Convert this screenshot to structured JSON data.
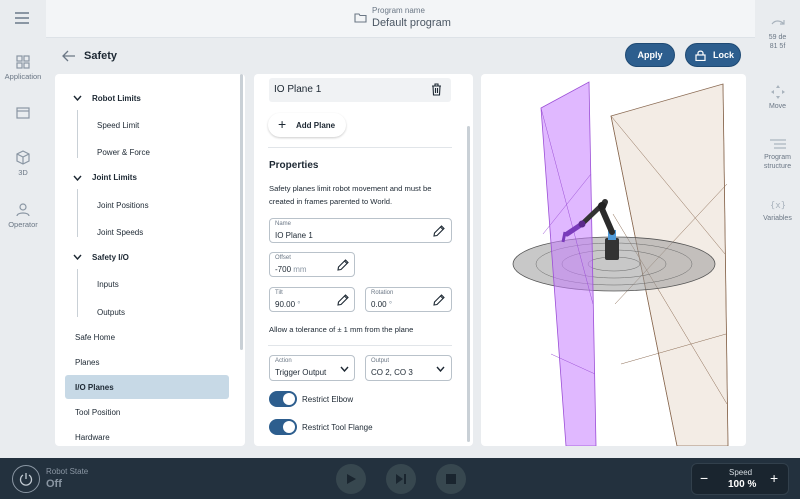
{
  "left_rail": {
    "items": [
      {
        "label": "Application",
        "icon": "grid-icon"
      },
      {
        "label": "",
        "icon": "window-icon"
      },
      {
        "label": "3D",
        "icon": "cube-icon"
      },
      {
        "label": "Operator",
        "icon": "person-icon"
      }
    ]
  },
  "right_rail": {
    "items": [
      {
        "label": "59 de\n81 5f",
        "icon": "handguide-icon"
      },
      {
        "label": "Move",
        "icon": "move-icon"
      },
      {
        "label": "Program\nstructure",
        "icon": "list-icon"
      },
      {
        "label": "Variables",
        "icon": "variable-icon"
      }
    ]
  },
  "header": {
    "program_label": "Program name",
    "program_name": "Default program"
  },
  "page": {
    "title": "Safety",
    "apply_label": "Apply",
    "lock_label": "Lock"
  },
  "nav": {
    "groups": [
      {
        "label": "Robot Limits",
        "items": [
          "Speed Limit",
          "Power & Force"
        ]
      },
      {
        "label": "Joint Limits",
        "items": [
          "Joint Positions",
          "Joint Speeds"
        ]
      },
      {
        "label": "Safety I/O",
        "items": [
          "Inputs",
          "Outputs"
        ]
      }
    ],
    "flat_items": [
      "Safe Home",
      "Planes",
      "I/O Planes",
      "Tool Position",
      "Hardware"
    ],
    "selected": "I/O Planes"
  },
  "plane": {
    "name_header": "IO Plane 1",
    "add_label": "Add Plane",
    "properties_title": "Properties",
    "description": "Safety planes limit robot movement and must be created in frames parented to World.",
    "name_field": {
      "label": "Name",
      "value": "IO Plane 1"
    },
    "offset_field": {
      "label": "Offset",
      "value": "-700",
      "unit": "mm"
    },
    "tilt_field": {
      "label": "Tilt",
      "value": "90.00",
      "unit": "°"
    },
    "rotation_field": {
      "label": "Rotation",
      "value": "0.00",
      "unit": "°"
    },
    "tolerance_note": "Allow a tolerance of ± 1 mm from the plane",
    "action_field": {
      "label": "Action",
      "value": "Trigger Output"
    },
    "output_field": {
      "label": "Output",
      "value": "CO 2, CO 3"
    },
    "toggles": [
      {
        "label": "Restrict Elbow",
        "on": true
      },
      {
        "label": "Restrict Tool Flange",
        "on": true
      }
    ]
  },
  "bottom": {
    "robot_state_label": "Robot State",
    "robot_state_value": "Off",
    "speed_label": "Speed",
    "speed_value": "100 %"
  },
  "colors": {
    "accent": "#2d5e8e",
    "selected_bg": "#c7d9e6",
    "bottom_bar": "#23313e",
    "purple_plane": "#c77dff",
    "beige_plane": "#e8d8c8"
  }
}
